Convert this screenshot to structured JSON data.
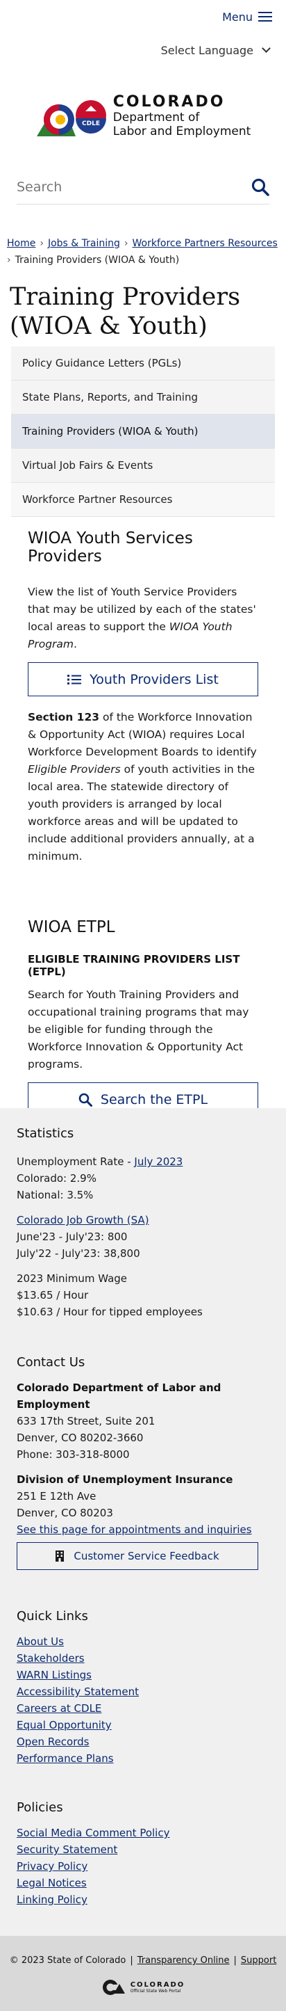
{
  "header": {
    "menu_label": "Menu",
    "language_label": "Select Language",
    "logo": {
      "state": "COLORADO",
      "dept_line1": "Department of",
      "dept_line2": "Labor and Employment",
      "badge": "CDLE"
    },
    "search_placeholder": "Search"
  },
  "breadcrumb": {
    "home": "Home",
    "jobs": "Jobs & Training",
    "partners": "Workforce Partners Resources",
    "current": "Training Providers (WIOA & Youth)"
  },
  "page_title": "Training Providers (WIOA & Youth)",
  "sidenav": [
    {
      "label": "Policy Guidance Letters (PGLs)"
    },
    {
      "label": "State Plans, Reports, and Training"
    },
    {
      "label": "Training Providers (WIOA & Youth)"
    },
    {
      "label": "Virtual Job Fairs & Events"
    },
    {
      "label": "Workforce Partner Resources"
    }
  ],
  "youth": {
    "heading": "WIOA Youth Services Providers",
    "intro_text": "View the list of Youth Service Providers that may be utilized by each of the states' local areas to support the",
    "intro_em": "WIOA Youth Program",
    "intro_end": ".",
    "button_label": "Youth Providers List",
    "body_bold": "Section 123",
    "body_1": "of the Workforce Innovation & Opportunity Act (WIOA) requires Local Workforce Development Boards to identify",
    "body_em": "Eligible Providers",
    "body_2": "of youth activities in the local area. The statewide directory of youth providers is arranged by local workforce areas and will be updated to include additional providers annually, at a minimum."
  },
  "etpl": {
    "heading": "WIOA ETPL",
    "subheading": "ELIGIBLE TRAINING PROVIDERS LIST (ETPL)",
    "body": "Search for Youth Training Providers and occupational training programs that may be eligible for funding through the Workforce Innovation & Opportunity Act programs.",
    "button_label": "Search the ETPL"
  },
  "statistics": {
    "heading": "Statistics",
    "unemployment_label": "Unemployment Rate - ",
    "unemployment_link": "July 2023",
    "colorado_rate": "Colorado: 2.9%",
    "national_rate": "National: 3.5%",
    "growth_link": "Colorado Job Growth (SA)",
    "growth_month": "June'23 - July'23: 800",
    "growth_year": "July'22 - July'23: 38,800",
    "min_wage_label": "2023 Minimum Wage",
    "min_wage": "$13.65 / Hour",
    "tipped_wage": "$10.63 / Hour for tipped employees"
  },
  "contact": {
    "heading": "Contact Us",
    "org": "Colorado Department of Labor and Employment",
    "address1": "633 17th Street, Suite 201",
    "address2": "Denver, CO  80202-3660",
    "phone": "Phone: 303-318-8000",
    "ui_org": "Division of Unemployment Insurance",
    "ui_address1": "251 E 12th Ave",
    "ui_address2": "Denver, CO  80203",
    "appointments_link": "See this page for appointments and inquiries",
    "feedback_button": "Customer Service Feedback"
  },
  "quick_links": {
    "heading": "Quick Links",
    "items": [
      "About Us",
      "Stakeholders",
      "WARN Listings",
      "Accessibility Statement",
      "Careers at CDLE",
      "Equal Opportunity",
      "Open Records",
      "Performance Plans"
    ]
  },
  "policies": {
    "heading": "Policies",
    "items": [
      "Social Media Comment Policy",
      "Security Statement",
      "Privacy Policy",
      "Legal Notices",
      "Linking Policy"
    ]
  },
  "bottom": {
    "copyright": "© 2023 State of Colorado",
    "divider": "|",
    "transparency": "Transparency Online",
    "support": "Support",
    "portal_name": "COLORADO",
    "portal_sub": "Official State Web Portal"
  },
  "colors": {
    "brand_blue": "#0b2a6f",
    "co_red": "#c8102e",
    "co_gold": "#f6b600",
    "footer_gray": "#f0f0f0"
  }
}
